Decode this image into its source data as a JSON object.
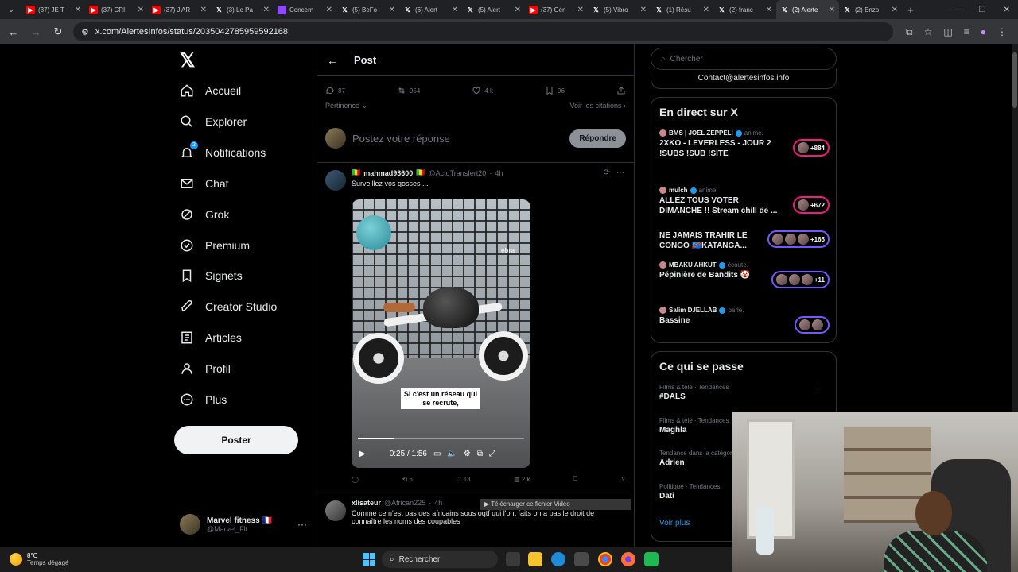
{
  "browser": {
    "tabs": [
      {
        "label": "(37) JE T",
        "icon": "youtube-icon"
      },
      {
        "label": "(37) CRI",
        "icon": "youtube-icon"
      },
      {
        "label": "(37) J'AR",
        "icon": "youtube-icon"
      },
      {
        "label": "(3) Le Pa",
        "icon": "x-icon"
      },
      {
        "label": "Concern",
        "icon": "twitch-icon"
      },
      {
        "label": "(5) BeFo",
        "icon": "x-icon"
      },
      {
        "label": "(6) Alert",
        "icon": "x-icon"
      },
      {
        "label": "(5) Alert",
        "icon": "x-icon"
      },
      {
        "label": "(37) Gén",
        "icon": "youtube-icon"
      },
      {
        "label": "(5) Vibro",
        "icon": "x-icon"
      },
      {
        "label": "(1) Résu",
        "icon": "x-icon"
      },
      {
        "label": "(2) franc",
        "icon": "x-icon"
      },
      {
        "label": "(2) Alerte",
        "icon": "x-icon",
        "active": true
      },
      {
        "label": "(2) Enzo",
        "icon": "x-icon"
      }
    ],
    "url": "x.com/AlertesInfos/status/2035042785959592168"
  },
  "sidebar": {
    "items": [
      {
        "label": "Accueil",
        "icon": "home-icon"
      },
      {
        "label": "Explorer",
        "icon": "search-icon"
      },
      {
        "label": "Notifications",
        "icon": "bell-icon",
        "badge": "2"
      },
      {
        "label": "Chat",
        "icon": "mail-icon"
      },
      {
        "label": "Grok",
        "icon": "grok-icon"
      },
      {
        "label": "Premium",
        "icon": "verified-icon"
      },
      {
        "label": "Signets",
        "icon": "bookmark-icon"
      },
      {
        "label": "Creator Studio",
        "icon": "rocket-icon"
      },
      {
        "label": "Articles",
        "icon": "article-icon"
      },
      {
        "label": "Profil",
        "icon": "person-icon"
      },
      {
        "label": "Plus",
        "icon": "more-circle-icon"
      }
    ],
    "post_button": "Poster",
    "account": {
      "name": "Marvel fitness 🇫🇷",
      "handle": "@Marvel_Flt"
    }
  },
  "main": {
    "header_title": "Post",
    "stats": {
      "replies": "87",
      "reposts": "954",
      "likes": "4 k",
      "bookmarks": "96"
    },
    "sort_label": "Pertinence",
    "quotes_label": "Voir les citations",
    "reply_placeholder": "Postez votre réponse",
    "reply_button": "Répondre",
    "tweet1": {
      "name": "mahmad93600",
      "handle": "@ActuTransfert20",
      "time": "4h",
      "text": "Surveillez vos gosses ...",
      "video": {
        "watermark": "ebra",
        "caption": "Si c'est un réseau qui se recrute,",
        "time": "0:25 / 1:56",
        "progress": 0.22
      },
      "actions": {
        "replies": "",
        "reposts": "6",
        "likes": "13",
        "views": "2 k"
      }
    },
    "tweet2": {
      "name": "xlisateur",
      "handle": "@African225",
      "time": "4h",
      "text": "Comme ce n'est pas des africains sous oqtf qui l'ont faits on a pas le droit de connaître les noms des coupables"
    },
    "download_overlay": "Télécharger ce fichier Vidéo"
  },
  "right": {
    "search_placeholder": "Chercher",
    "contact": "Contact@alertesinfos.info",
    "live_title": "En direct sur X",
    "live": [
      {
        "host": "BMS | JOEL ZEPPELI",
        "state": "anime.",
        "title": "2XKO - LEVERLESS - JOUR 2 !SUBS !SUB !SITE",
        "count": "+884",
        "color": "#f91880"
      },
      {
        "host": "mulch",
        "state": "anime.",
        "title": "ALLEZ TOUS VOTER DIMANCHE !! Stream chill de ...",
        "count": "+672",
        "color": "#f91880"
      },
      {
        "host": "",
        "state": "",
        "title": "NE JAMAIS TRAHIR LE CONGO 🇨🇩KATANGA...",
        "count": "+165",
        "color": "#7856ff"
      },
      {
        "host": "MBAKU AHKUT",
        "state": "écoute.",
        "title": "Pépinière de Bandits 🤡",
        "count": "+11",
        "color": "#7856ff"
      },
      {
        "host": "Salim DJELLAB",
        "state": "parle.",
        "title": "Bassine",
        "count": "",
        "color": "#7856ff"
      }
    ],
    "trends_title": "Ce qui se passe",
    "trends": [
      {
        "category": "Films & télé · Tendances",
        "name": "#DALS"
      },
      {
        "category": "Films & télé · Tendances",
        "name": "Maghla"
      },
      {
        "category": "Tendance dans la catégorie",
        "name": "Adrien"
      },
      {
        "category": "Politique · Tendances",
        "name": "Dati"
      }
    ],
    "see_more": "Voir plus"
  },
  "taskbar": {
    "temp": "8°C",
    "weather": "Temps dégagé",
    "search": "Rechercher"
  }
}
